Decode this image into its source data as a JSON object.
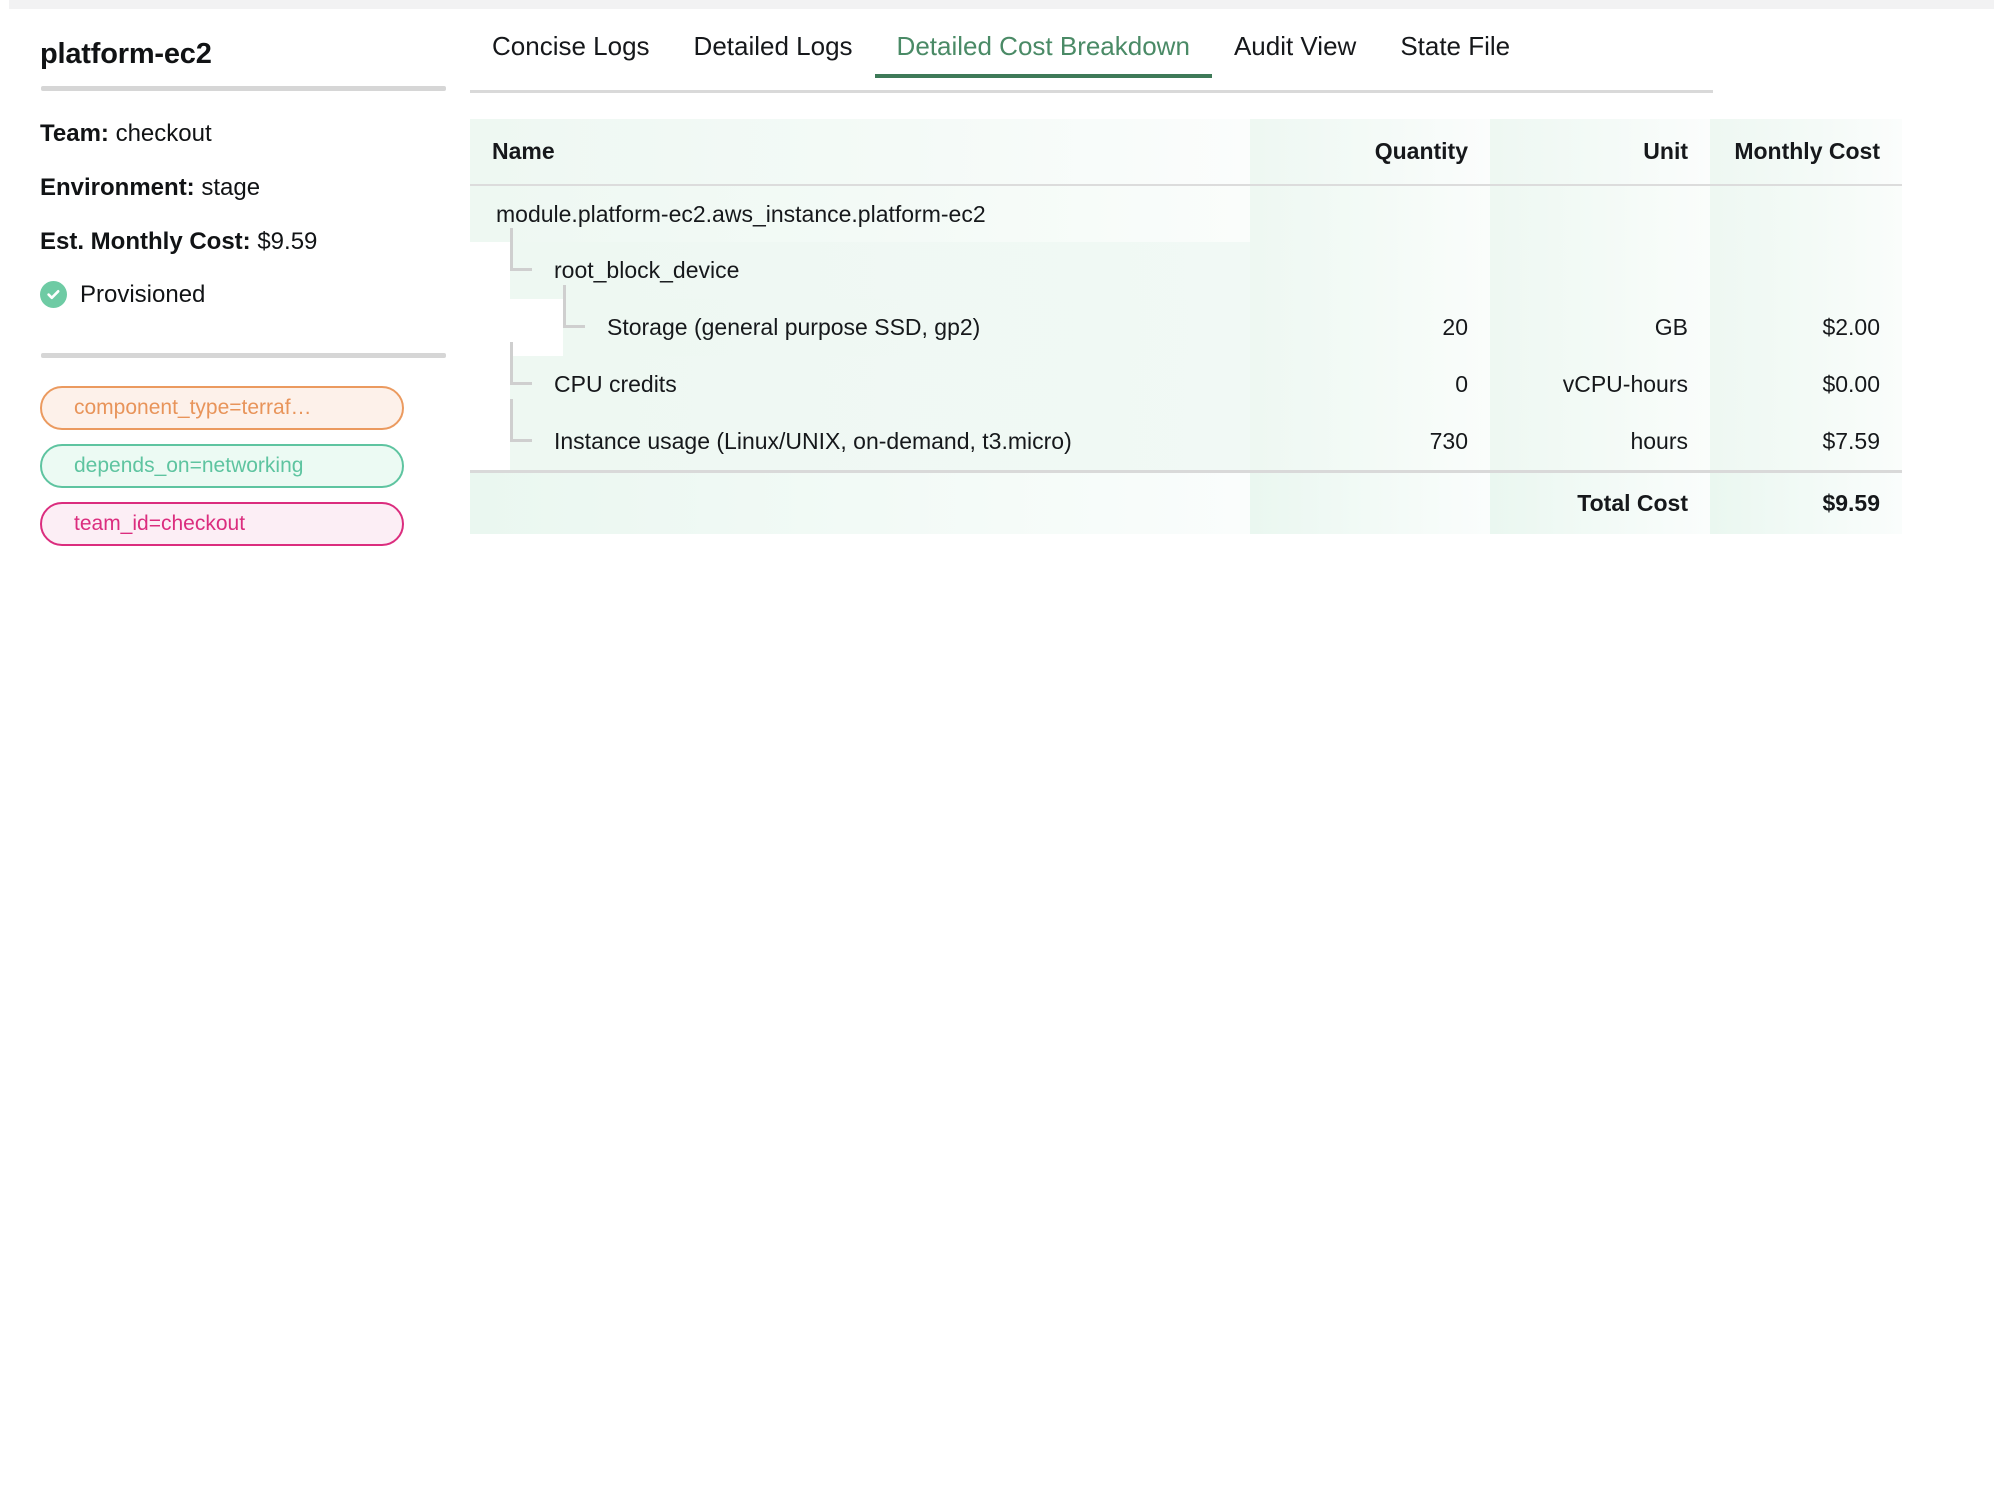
{
  "sidebar": {
    "resource_title": "platform-ec2",
    "fields": [
      {
        "label": "Team:",
        "value": "checkout"
      },
      {
        "label": "Environment:",
        "value": "stage"
      },
      {
        "label": "Est. Monthly Cost:",
        "value": "$9.59"
      }
    ],
    "status": {
      "icon": "check-circle-icon",
      "label": "Provisioned",
      "color": "#6ecba4"
    },
    "tags": [
      {
        "text": "component_type=terraf…",
        "color": "#e8945a",
        "bg": "#fdf1ea",
        "border": "#eb9a5f"
      },
      {
        "text": "depends_on=networking",
        "color": "#5ec4a0",
        "bg": "#ecfaf3",
        "border": "#5ec4a0"
      },
      {
        "text": "team_id=checkout",
        "color": "#db2d7e",
        "bg": "#fceef5",
        "border": "#db2d7e"
      }
    ]
  },
  "tabs": [
    {
      "label": "Concise Logs",
      "active": false
    },
    {
      "label": "Detailed Logs",
      "active": false
    },
    {
      "label": "Detailed Cost Breakdown",
      "active": true
    },
    {
      "label": "Audit View",
      "active": false
    },
    {
      "label": "State File",
      "active": false
    }
  ],
  "active_tab_color": "#4a8a66",
  "cost_table": {
    "columns": [
      "Name",
      "Quantity",
      "Unit",
      "Monthly Cost"
    ],
    "rows": [
      {
        "level": 0,
        "name": "module.platform-ec2.aws_instance.platform-ec2",
        "quantity": "",
        "unit": "",
        "monthly_cost": ""
      },
      {
        "level": 1,
        "name": "root_block_device",
        "quantity": "",
        "unit": "",
        "monthly_cost": ""
      },
      {
        "level": 2,
        "name": "Storage (general purpose SSD, gp2)",
        "quantity": "20",
        "unit": "GB",
        "monthly_cost": "$2.00"
      },
      {
        "level": 1,
        "name": "CPU credits",
        "quantity": "0",
        "unit": "vCPU-hours",
        "monthly_cost": "$0.00"
      },
      {
        "level": 1,
        "name": "Instance usage (Linux/UNIX, on-demand, t3.micro)",
        "quantity": "730",
        "unit": "hours",
        "monthly_cost": "$7.59"
      }
    ],
    "total": {
      "label": "Total Cost",
      "value": "$9.59"
    }
  }
}
